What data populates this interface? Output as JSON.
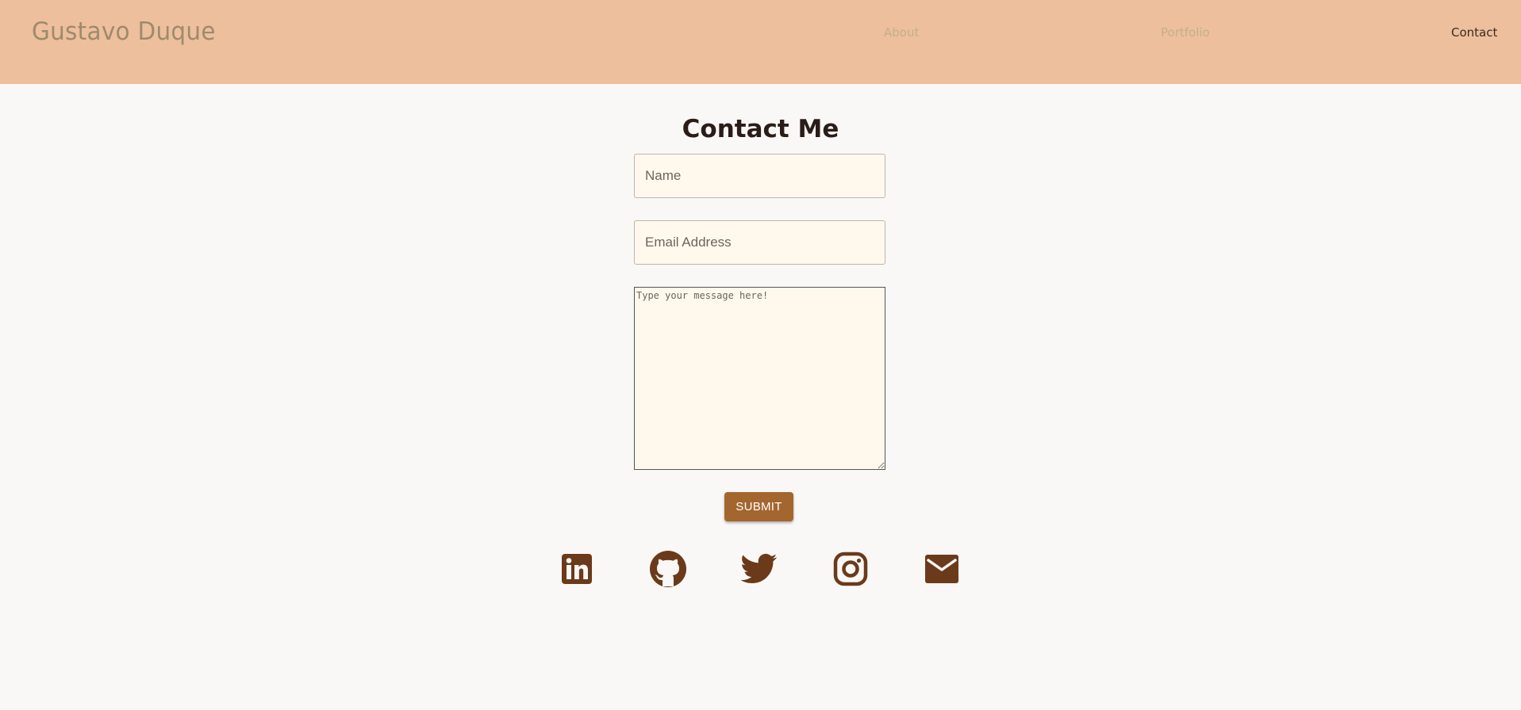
{
  "header": {
    "brand": "Gustavo Duque",
    "nav": {
      "about": "About",
      "portfolio": "Portfolio",
      "contact": "Contact"
    }
  },
  "main": {
    "title": "Contact Me",
    "form": {
      "name_placeholder": "Name",
      "name_value": "",
      "email_placeholder": "Email Address",
      "email_value": "",
      "message_placeholder": "Type your message here!",
      "message_value": "",
      "submit_label": "SUBMIT"
    }
  },
  "social": [
    {
      "icon": "linkedin-icon"
    },
    {
      "icon": "github-icon"
    },
    {
      "icon": "twitter-icon"
    },
    {
      "icon": "instagram-icon"
    },
    {
      "icon": "email-icon"
    }
  ],
  "colors": {
    "header_bg": "#eebf9c",
    "page_bg": "#faf8f6",
    "accent_button": "#a4662f",
    "icon_color": "#6b3a1a",
    "field_bg": "#fff9ed"
  }
}
